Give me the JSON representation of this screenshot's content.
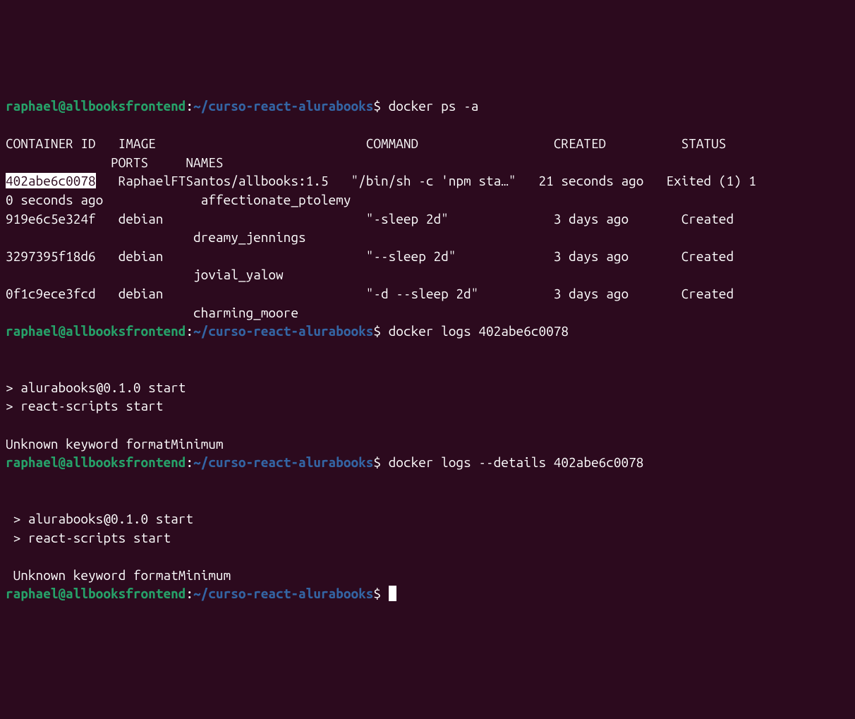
{
  "prompt": {
    "user_host": "raphael@allbooksfrontend",
    "colon": ":",
    "path": "~/curso-react-alurabooks",
    "dollar": "$"
  },
  "commands": {
    "cmd1": "docker ps -a",
    "cmd2": "docker logs 402abe6c0078",
    "cmd3": "docker logs --details 402abe6c0078",
    "cmd4": ""
  },
  "table_header": {
    "line1": "CONTAINER ID   IMAGE                            COMMAND                  CREATED          STATUS",
    "line2": "              PORTS     NAMES"
  },
  "containers": {
    "row1_id": "402abe6c0078",
    "row1_a": "   RaphaelFTSantos/allbooks:1.5   \"/bin/sh -c 'npm sta…\"   21 seconds ago   Exited (1) 1",
    "row1_b": "0 seconds ago             affectionate_ptolemy",
    "row2_a": "919e6c5e324f   debian                           \"-sleep 2d\"              3 days ago       Created",
    "row2_b": "                         dreamy_jennings",
    "row3_a": "3297395f18d6   debian                           \"--sleep 2d\"             3 days ago       Created",
    "row3_b": "                         jovial_yalow",
    "row4_a": "0f1c9ece3fcd   debian                           \"-d --sleep 2d\"          3 days ago       Created",
    "row4_b": "                         charming_moore"
  },
  "logs": {
    "l1": "",
    "l2": "> alurabooks@0.1.0 start",
    "l3": "> react-scripts start",
    "l4": "",
    "l5": "Unknown keyword formatMinimum",
    "l6": "",
    "l7": " > alurabooks@0.1.0 start",
    "l8": " > react-scripts start",
    "l9": "",
    "l10": " Unknown keyword formatMinimum"
  }
}
